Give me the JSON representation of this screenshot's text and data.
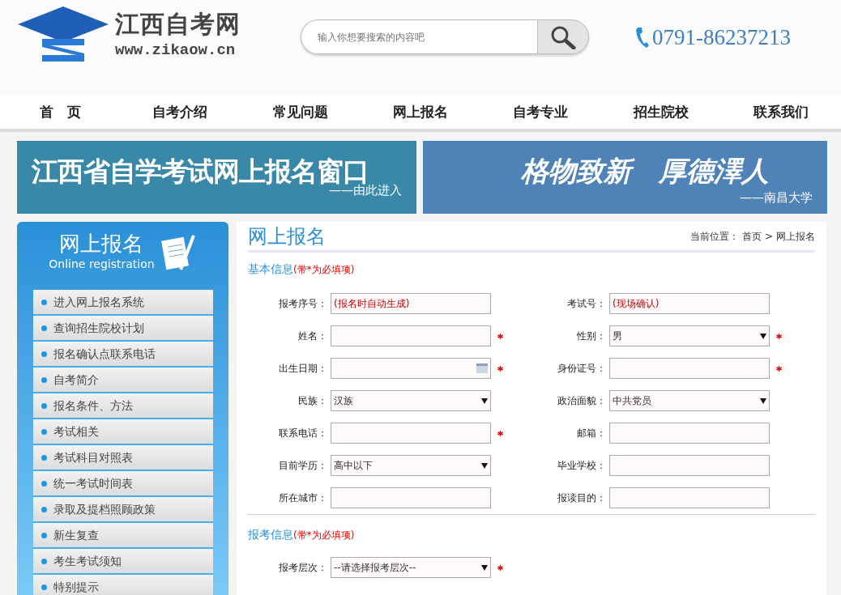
{
  "header": {
    "logo_title": "江西自考网",
    "logo_url": "www.zikaow.cn",
    "search": {
      "placeholder": "输入你想要搜索的内容吧"
    },
    "phone": "0791-86237213"
  },
  "nav": [
    {
      "label": "首　页"
    },
    {
      "label": "自考介绍"
    },
    {
      "label": "常见问题"
    },
    {
      "label": "网上报名"
    },
    {
      "label": "自考专业"
    },
    {
      "label": "招生院校"
    },
    {
      "label": "联系我们"
    }
  ],
  "banners": [
    {
      "title": "江西省自学考试网上报名窗口",
      "subtitle": "——由此进入"
    },
    {
      "title": "格物致新　厚德澤人",
      "subtitle": "——南昌大学"
    }
  ],
  "sidebar": {
    "title": "网上报名",
    "subtitle": "Online registration",
    "items": [
      {
        "label": "进入网上报名系统"
      },
      {
        "label": "查询招生院校计划"
      },
      {
        "label": "报名确认点联系电话"
      },
      {
        "label": "自考简介"
      },
      {
        "label": "报名条件、方法"
      },
      {
        "label": "考试相关"
      },
      {
        "label": "考试科目对照表"
      },
      {
        "label": "统一考试时间表"
      },
      {
        "label": "录取及提档照顾政策"
      },
      {
        "label": "新生复查"
      },
      {
        "label": "考生考试须知"
      },
      {
        "label": "特别提示"
      }
    ]
  },
  "main": {
    "title": "网上报名",
    "breadcrumb": {
      "prefix": "当前位置：",
      "items": [
        "首页",
        "网上报名"
      ],
      "separator": ">"
    },
    "sections": [
      {
        "title": "基本信息",
        "note": "(带*为必填项)",
        "fields": [
          {
            "label": "报考序号：",
            "kind": "auto",
            "value": "(报名时自动生成)",
            "required": false
          },
          {
            "label": "考试号：",
            "kind": "auto",
            "value": "(现场确认)",
            "required": false
          },
          {
            "label": "姓名：",
            "kind": "text",
            "required": true
          },
          {
            "label": "性别：",
            "kind": "select",
            "value": "男",
            "required": true
          },
          {
            "label": "出生日期：",
            "kind": "date",
            "required": true
          },
          {
            "label": "身份证号：",
            "kind": "text",
            "required": true
          },
          {
            "label": "民族：",
            "kind": "select",
            "value": "汉族",
            "required": false
          },
          {
            "label": "政治面貌：",
            "kind": "select",
            "value": "中共党员",
            "required": false
          },
          {
            "label": "联系电话：",
            "kind": "text",
            "required": true
          },
          {
            "label": "邮箱：",
            "kind": "text",
            "required": false
          },
          {
            "label": "目前学历：",
            "kind": "select",
            "value": "高中以下",
            "required": false
          },
          {
            "label": "毕业学校：",
            "kind": "text",
            "required": false
          },
          {
            "label": "所在城市：",
            "kind": "text",
            "required": false
          },
          {
            "label": "报读目的：",
            "kind": "text",
            "required": false
          }
        ]
      },
      {
        "title": "报考信息",
        "note": "(带*为必填项)",
        "fields": [
          {
            "label": "报考层次：",
            "kind": "select",
            "value": "--请选择报考层次--",
            "required": true
          }
        ]
      }
    ]
  }
}
